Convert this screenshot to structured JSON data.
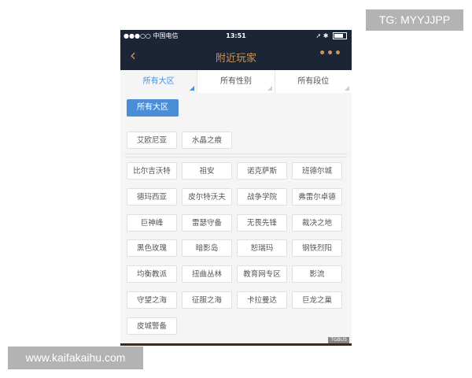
{
  "status_bar": {
    "carrier": "●●●○○ 中国电信",
    "wifi_icon": "wifi-icon",
    "time": "13:51",
    "right_icons": "➚ ✱"
  },
  "nav": {
    "title": "附近玩家",
    "back": "‹",
    "more": "•••"
  },
  "tabs": [
    "所有大区",
    "所有性别",
    "所有段位"
  ],
  "selected_label": "所有大区",
  "regions_top": [
    "艾欧尼亚",
    "水晶之痕"
  ],
  "regions": [
    "比尔吉沃特",
    "祖安",
    "诺克萨斯",
    "班德尔城",
    "德玛西亚",
    "皮尔特沃夫",
    "战争学院",
    "弗雷尔卓德",
    "巨神峰",
    "雷瑟守备",
    "无畏先锋",
    "裁决之地",
    "黑色玫瑰",
    "暗影岛",
    "恕瑞玛",
    "钢铁烈阳",
    "均衡教派",
    "扭曲丛林",
    "教育网专区",
    "影流",
    "守望之海",
    "征服之海",
    "卡拉曼达",
    "巨龙之巢",
    "皮城警备"
  ],
  "corner_watermark": "TGBUS",
  "watermarks": {
    "tg": "TG: MYYJJPP",
    "site": "www.kaifakaihu.com"
  },
  "colors": {
    "nav_bg": "#1c2536",
    "accent_gold": "#c89660",
    "active_blue": "#4a8fd6"
  }
}
